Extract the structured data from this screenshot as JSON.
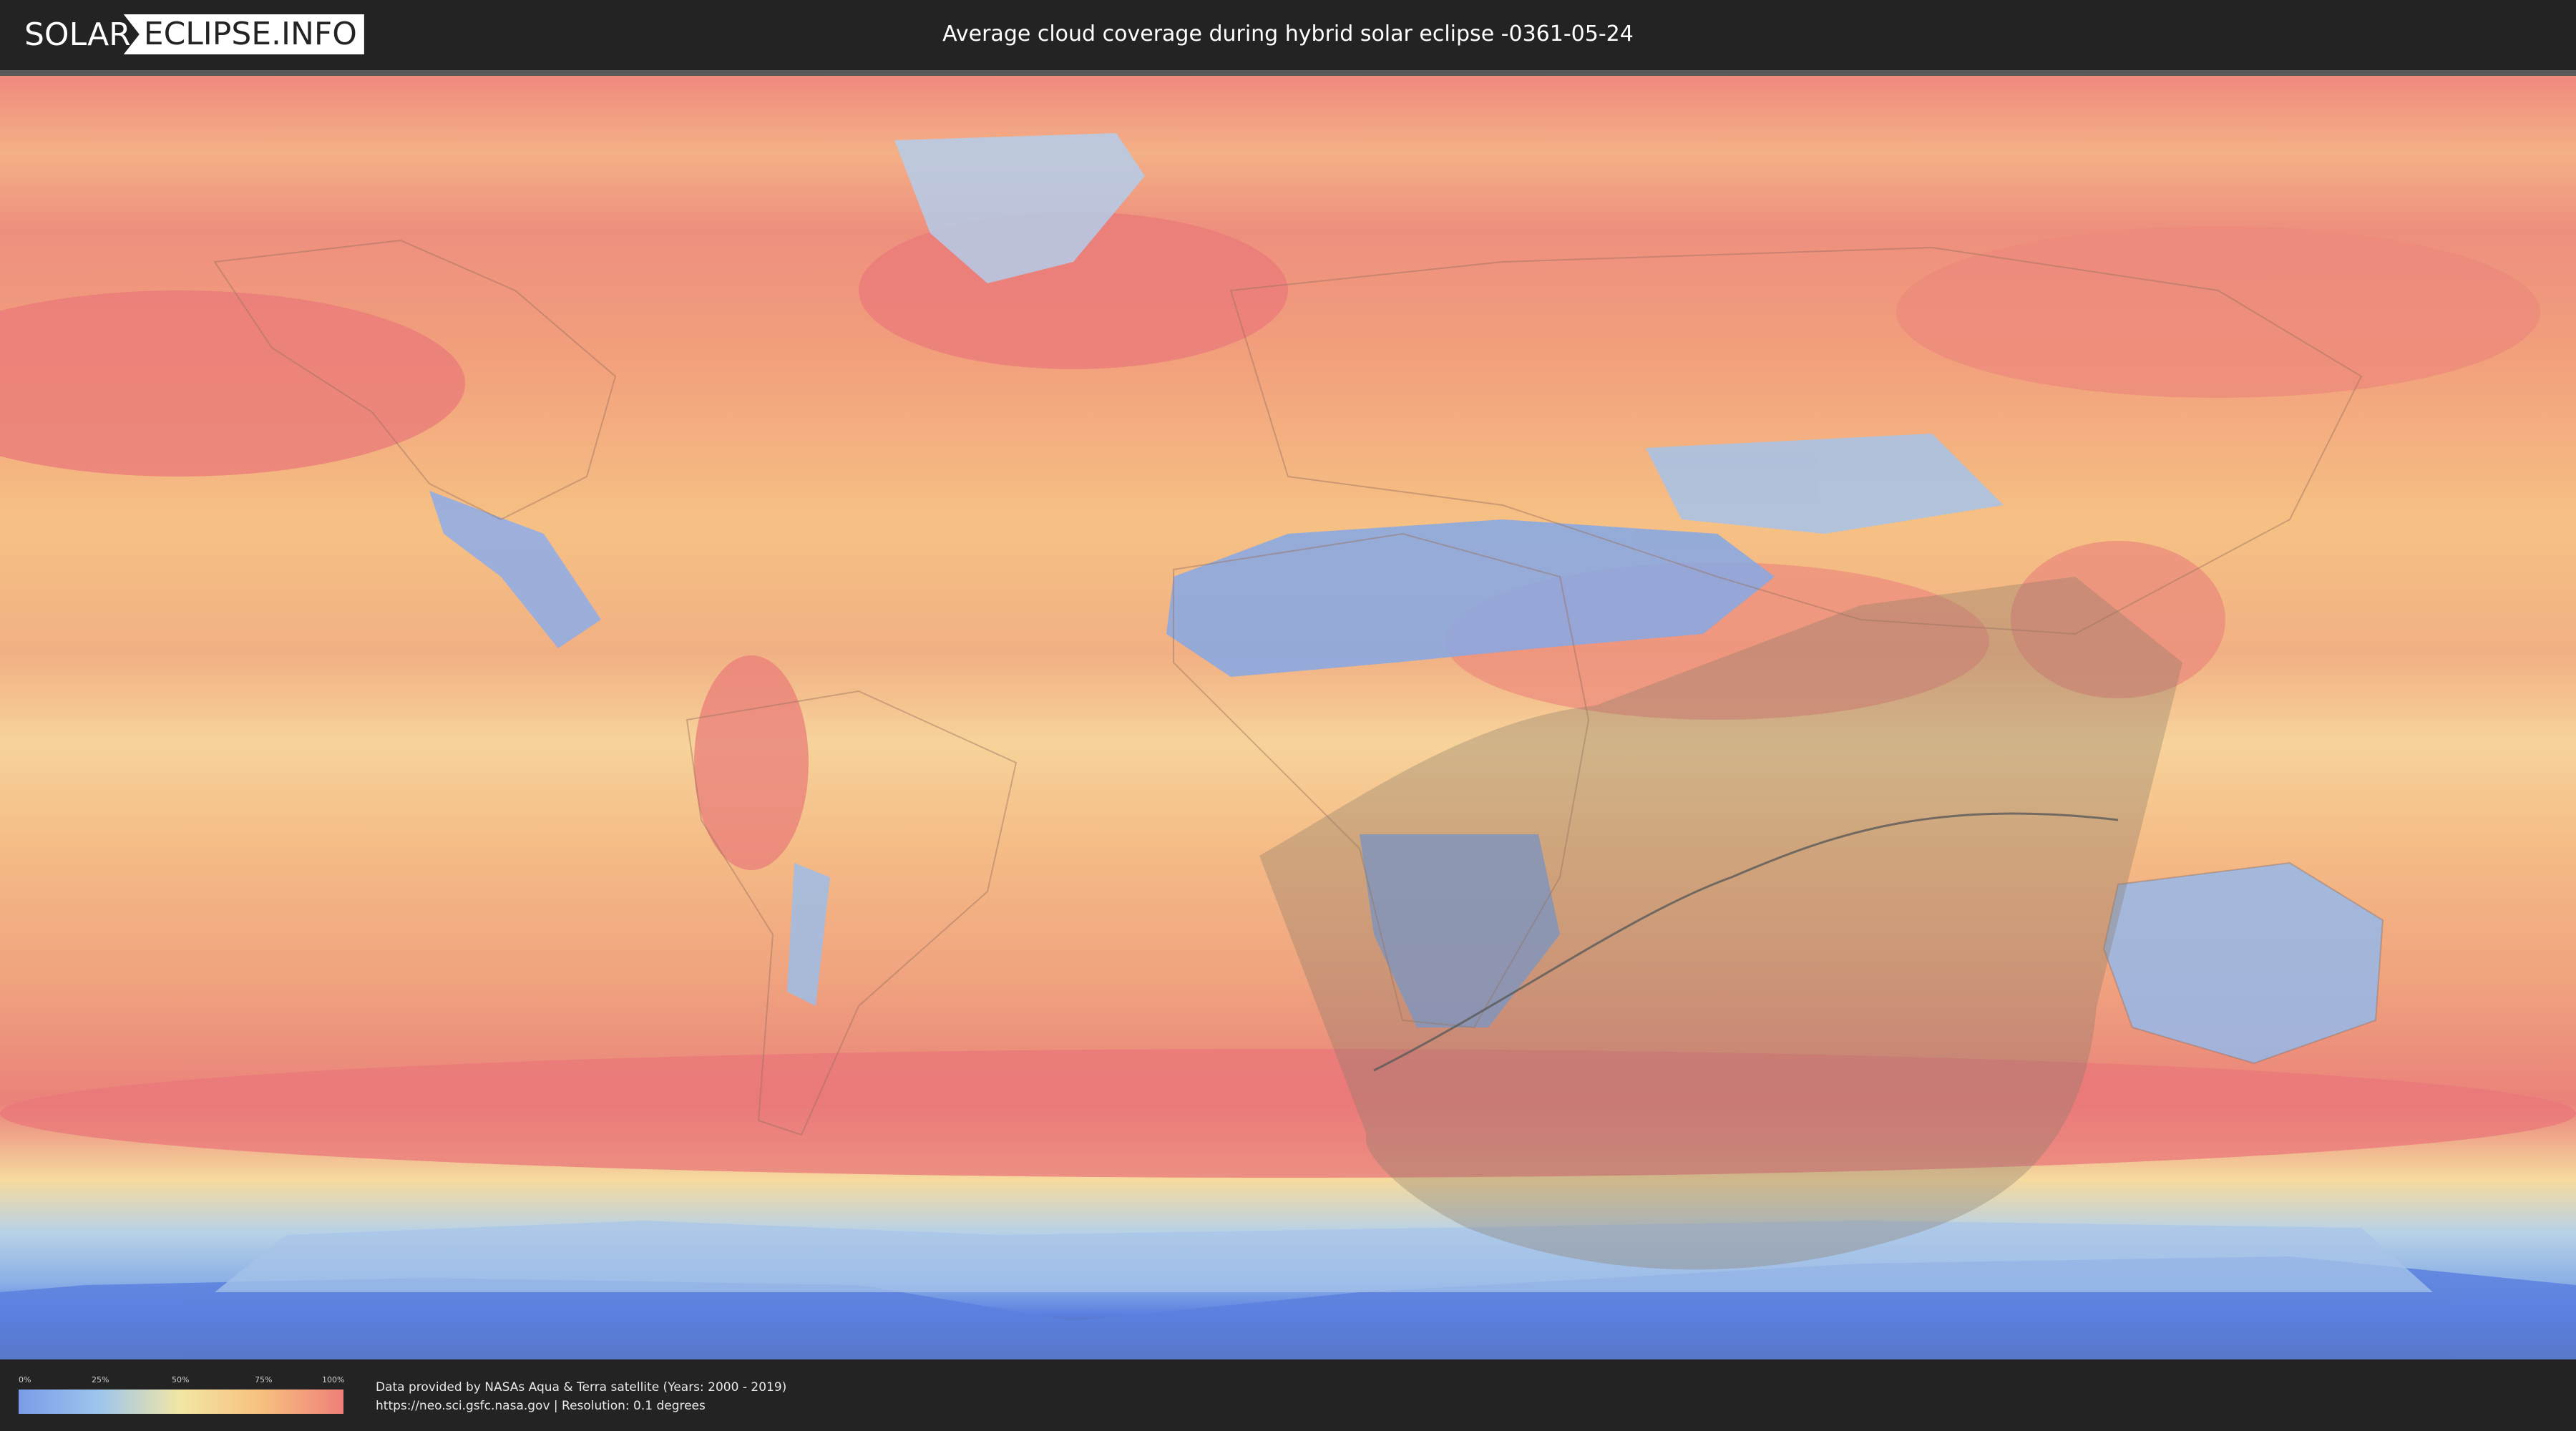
{
  "header": {
    "logo_part1": "SOLAR",
    "logo_part2": "ECLIPSE.INFO",
    "title": "Average cloud coverage during hybrid solar eclipse -0361-05-24"
  },
  "legend": {
    "ticks": [
      "0%",
      "25%",
      "50%",
      "75%",
      "100%"
    ],
    "colors": [
      "#7a9ce8",
      "#9ec6ec",
      "#f3e6a4",
      "#f7c07e",
      "#ef7f7a"
    ]
  },
  "footer": {
    "credit_line1": "Data provided by NASAs Aqua & Terra satellite (Years: 2000 - 2019)",
    "credit_line2": "https://neo.sci.gsfc.nasa.gov | Resolution: 0.1 degrees"
  },
  "map": {
    "background_ocean": "#f3a07a",
    "clear_sky": "#7ea3e6",
    "cloudy": "#e9777a",
    "eclipse_overlay": "#8a7a6a"
  }
}
